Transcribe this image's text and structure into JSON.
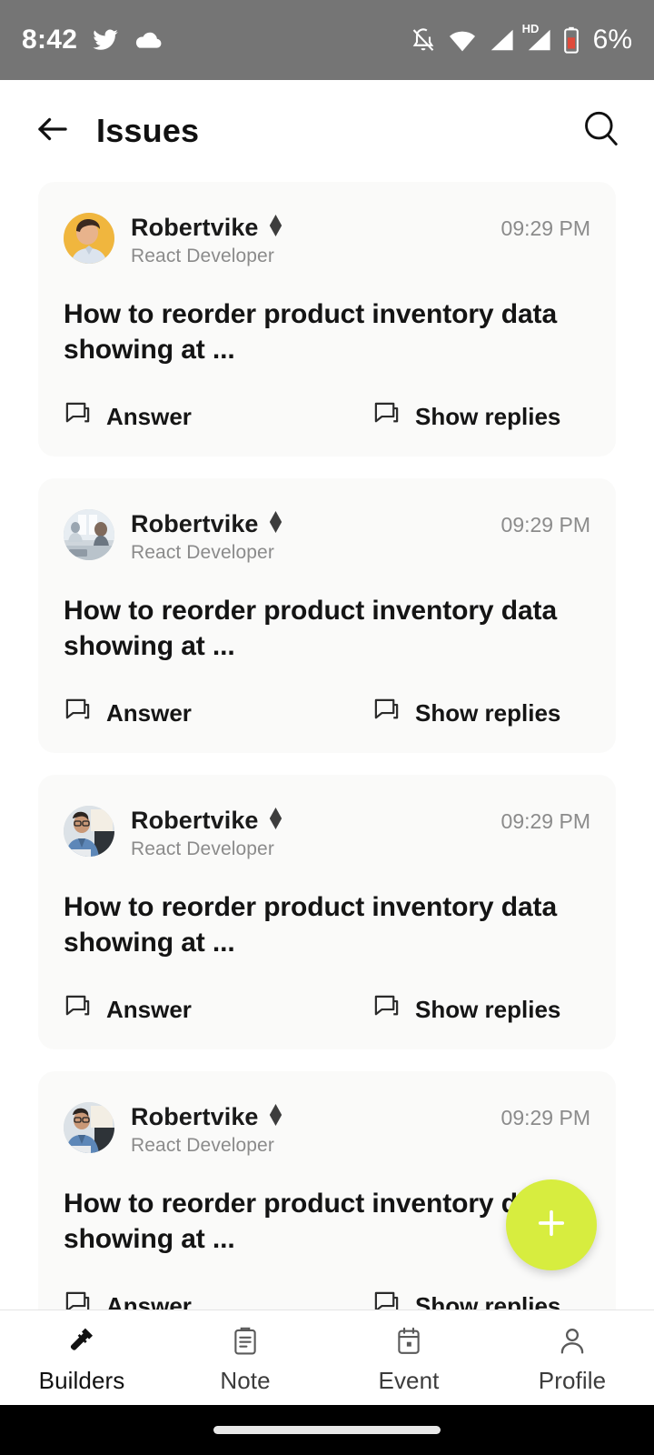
{
  "status_bar": {
    "time": "8:42",
    "battery_percent": "6%",
    "network_label": "HD",
    "icons": [
      "twitter-icon",
      "cloud-icon",
      "notifications-off-icon",
      "wifi-icon",
      "signal-icon",
      "signal-hd-icon",
      "battery-low-icon"
    ],
    "background": "#757575"
  },
  "header": {
    "back_label": "back-arrow-icon",
    "title": "Issues",
    "search_label": "search-icon"
  },
  "feed": {
    "cards": [
      {
        "username": "Robertvike",
        "verified_badge": "diamond-badge-icon",
        "role": "React Developer",
        "time": "09:29 PM",
        "title": "How to reorder product inventory data showing at ...",
        "answer_label": "Answer",
        "replies_label": "Show replies",
        "avatar": "portrait-curly-hair-yellow"
      },
      {
        "username": "Robertvike",
        "verified_badge": "diamond-badge-icon",
        "role": "React Developer",
        "time": "09:29 PM",
        "title": "How to reorder product inventory data showing at ...",
        "answer_label": "Answer",
        "replies_label": "Show replies",
        "avatar": "office-desk-gray"
      },
      {
        "username": "Robertvike",
        "verified_badge": "diamond-badge-icon",
        "role": "React Developer",
        "time": "09:29 PM",
        "title": "How to reorder product inventory data showing at ...",
        "answer_label": "Answer",
        "replies_label": "Show replies",
        "avatar": "man-glasses-denim"
      },
      {
        "username": "Robertvike",
        "verified_badge": "diamond-badge-icon",
        "role": "React Developer",
        "time": "09:29 PM",
        "title": "How to reorder product inventory data showing at ...",
        "answer_label": "Answer",
        "replies_label": "Show replies",
        "avatar": "man-glasses-denim"
      }
    ]
  },
  "fab": {
    "label": "add-icon",
    "color": "#D7ED3F"
  },
  "bottom_nav": {
    "items": [
      {
        "label": "Builders",
        "icon": "hammer-icon",
        "active": true
      },
      {
        "label": "Note",
        "icon": "clipboard-icon",
        "active": false
      },
      {
        "label": "Event",
        "icon": "calendar-icon",
        "active": false
      },
      {
        "label": "Profile",
        "icon": "person-icon",
        "active": false
      }
    ]
  },
  "theme": {
    "card_background": "#FAFAF9",
    "accent": "#D7ED3F",
    "text_primary": "#141414",
    "text_secondary": "#8b8b8b"
  }
}
